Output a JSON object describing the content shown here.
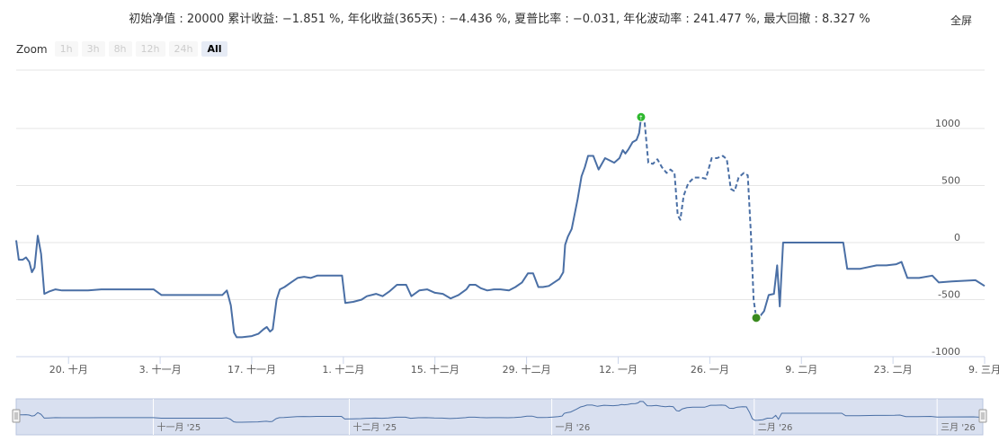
{
  "header": {
    "stats_text": "初始净值 : 20000 累计收益: −1.851 %, 年化收益(365天) : −4.436 %, 夏普比率 : −0.031, 年化波动率 : 241.477 %, 最大回撤 : 8.327 %",
    "fullscreen_label": "全屏"
  },
  "zoom": {
    "label": "Zoom",
    "buttons": [
      "1h",
      "3h",
      "8h",
      "12h",
      "24h",
      "All"
    ],
    "active": "All"
  },
  "colors": {
    "line": "#4a6fa5",
    "grid": "#e6e6e6",
    "axis_text": "#555555",
    "peak_marker": "#2eb82e",
    "trough_marker": "#3a8a1e",
    "navigator_fill": "#ccd6eb",
    "navigator_bg": "#f2f2f2"
  },
  "chart_data": {
    "type": "line",
    "title": "",
    "xlabel": "",
    "ylabel": "",
    "ylim": [
      -1000,
      1200
    ],
    "y_ticks": [
      -1000,
      -500,
      0,
      500,
      1000
    ],
    "x_ticks": [
      {
        "label": "20. 十月",
        "day": 19
      },
      {
        "label": "3. 十一月",
        "day": 33
      },
      {
        "label": "17. 十一月",
        "day": 47
      },
      {
        "label": "1. 十二月",
        "day": 61
      },
      {
        "label": "15. 十二月",
        "day": 75
      },
      {
        "label": "29. 十二月",
        "day": 89
      },
      {
        "label": "12. 一月",
        "day": 103
      },
      {
        "label": "26. 一月",
        "day": 117
      },
      {
        "label": "9. 二月",
        "day": 131
      },
      {
        "label": "23. 二月",
        "day": 145
      },
      {
        "label": "9. 三月",
        "day": 159
      }
    ],
    "x_range_days": [
      11,
      159
    ],
    "series": [
      {
        "style": "solid",
        "points": [
          [
            11.0,
            20
          ],
          [
            11.4,
            -150
          ],
          [
            12.0,
            -150
          ],
          [
            12.5,
            -130
          ],
          [
            13.0,
            -170
          ],
          [
            13.4,
            -260
          ],
          [
            13.8,
            -220
          ],
          [
            14.3,
            60
          ],
          [
            14.8,
            -100
          ],
          [
            15.3,
            -450
          ],
          [
            16.0,
            -430
          ],
          [
            17.0,
            -410
          ],
          [
            18.0,
            -420
          ],
          [
            20.0,
            -420
          ],
          [
            22.0,
            -420
          ],
          [
            24.0,
            -410
          ],
          [
            28.0,
            -410
          ],
          [
            32.0,
            -410
          ],
          [
            33.2,
            -460
          ],
          [
            35.0,
            -460
          ],
          [
            38.0,
            -460
          ],
          [
            41.0,
            -460
          ],
          [
            42.5,
            -460
          ],
          [
            43.2,
            -420
          ],
          [
            43.8,
            -550
          ],
          [
            44.3,
            -790
          ],
          [
            44.7,
            -830
          ],
          [
            45.5,
            -830
          ],
          [
            47.0,
            -820
          ],
          [
            48.0,
            -800
          ],
          [
            48.8,
            -760
          ],
          [
            49.3,
            -740
          ],
          [
            49.8,
            -780
          ],
          [
            50.2,
            -760
          ],
          [
            50.8,
            -500
          ],
          [
            51.3,
            -410
          ],
          [
            52.0,
            -390
          ],
          [
            53.0,
            -350
          ],
          [
            54.0,
            -310
          ],
          [
            55.0,
            -300
          ],
          [
            56.0,
            -310
          ],
          [
            57.0,
            -290
          ],
          [
            59.0,
            -290
          ],
          [
            60.8,
            -290
          ],
          [
            61.3,
            -530
          ],
          [
            62.5,
            -520
          ],
          [
            63.8,
            -500
          ],
          [
            64.6,
            -470
          ],
          [
            66.0,
            -450
          ],
          [
            67.0,
            -470
          ],
          [
            68.0,
            -430
          ],
          [
            69.2,
            -370
          ],
          [
            70.6,
            -370
          ],
          [
            71.4,
            -470
          ],
          [
            72.6,
            -420
          ],
          [
            73.8,
            -410
          ],
          [
            75.0,
            -440
          ],
          [
            76.2,
            -450
          ],
          [
            77.4,
            -490
          ],
          [
            78.6,
            -460
          ],
          [
            79.8,
            -410
          ],
          [
            80.3,
            -370
          ],
          [
            81.2,
            -370
          ],
          [
            82.0,
            -400
          ],
          [
            83.0,
            -420
          ],
          [
            84.0,
            -410
          ],
          [
            85.0,
            -410
          ],
          [
            86.3,
            -420
          ],
          [
            87.3,
            -390
          ],
          [
            88.3,
            -350
          ],
          [
            89.2,
            -270
          ],
          [
            90.0,
            -270
          ],
          [
            90.8,
            -390
          ],
          [
            91.5,
            -390
          ],
          [
            92.4,
            -380
          ],
          [
            93.2,
            -350
          ],
          [
            94.0,
            -320
          ],
          [
            94.6,
            -260
          ],
          [
            94.9,
            -20
          ],
          [
            95.3,
            50
          ],
          [
            95.9,
            120
          ],
          [
            96.8,
            380
          ],
          [
            97.4,
            580
          ],
          [
            97.9,
            660
          ],
          [
            98.4,
            760
          ],
          [
            99.2,
            760
          ],
          [
            100.0,
            640
          ],
          [
            101.0,
            740
          ],
          [
            102.4,
            700
          ],
          [
            103.2,
            740
          ],
          [
            103.7,
            810
          ],
          [
            104.1,
            780
          ],
          [
            104.6,
            820
          ],
          [
            105.2,
            880
          ],
          [
            105.8,
            900
          ],
          [
            106.2,
            960
          ],
          [
            106.5,
            1100
          ]
        ]
      },
      {
        "style": "dashed",
        "points": [
          [
            106.5,
            1100
          ],
          [
            107.0,
            1080
          ],
          [
            107.6,
            700
          ],
          [
            108.3,
            690
          ],
          [
            109.0,
            730
          ],
          [
            109.7,
            660
          ],
          [
            110.4,
            610
          ],
          [
            111.0,
            640
          ],
          [
            111.6,
            610
          ],
          [
            112.1,
            240
          ],
          [
            112.5,
            200
          ],
          [
            113.0,
            410
          ],
          [
            113.7,
            520
          ],
          [
            114.6,
            570
          ],
          [
            115.6,
            570
          ],
          [
            116.4,
            560
          ],
          [
            117.3,
            740
          ],
          [
            118.1,
            740
          ],
          [
            119.0,
            760
          ],
          [
            119.6,
            730
          ],
          [
            120.2,
            470
          ],
          [
            120.8,
            450
          ],
          [
            121.4,
            570
          ],
          [
            122.2,
            610
          ],
          [
            122.8,
            590
          ],
          [
            123.3,
            60
          ],
          [
            123.7,
            -500
          ],
          [
            124.1,
            -660
          ]
        ]
      },
      {
        "style": "solid",
        "points": [
          [
            124.1,
            -660
          ],
          [
            124.6,
            -650
          ],
          [
            125.3,
            -600
          ],
          [
            126.0,
            -460
          ],
          [
            126.8,
            -450
          ],
          [
            127.3,
            -200
          ],
          [
            127.7,
            -560
          ],
          [
            128.2,
            0
          ],
          [
            130.0,
            0
          ],
          [
            133.0,
            0
          ],
          [
            136.0,
            0
          ],
          [
            137.4,
            0
          ],
          [
            138.0,
            -230
          ],
          [
            140.0,
            -230
          ],
          [
            142.5,
            -200
          ],
          [
            144.0,
            -200
          ],
          [
            145.5,
            -190
          ],
          [
            146.3,
            -170
          ],
          [
            147.2,
            -310
          ],
          [
            149.0,
            -310
          ],
          [
            151.0,
            -290
          ],
          [
            152.0,
            -350
          ],
          [
            154.0,
            -340
          ],
          [
            157.6,
            -330
          ],
          [
            159.0,
            -380
          ]
        ]
      }
    ],
    "markers": [
      {
        "type": "peak",
        "x": 106.5,
        "y": 1100
      },
      {
        "type": "trough",
        "x": 124.1,
        "y": -660
      }
    ]
  },
  "navigator": {
    "labels": [
      "十一月 '25",
      "十二月 '25",
      "一月 '26",
      "二月 '26",
      "三月 '26"
    ],
    "label_days": [
      32,
      62,
      93,
      124,
      152
    ]
  }
}
